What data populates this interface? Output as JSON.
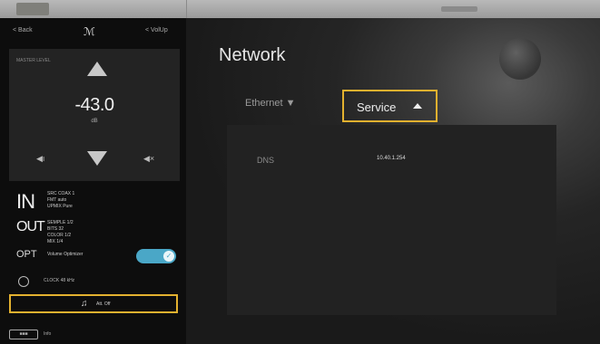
{
  "topbar": {},
  "sidebar": {
    "back_label": "< Back",
    "brand": "ℳ",
    "volume_up_label": "< VolUp",
    "volume": {
      "label": "MASTER LEVEL",
      "value": "-43.0",
      "unit": "dB"
    },
    "in_block": {
      "title": "IN",
      "lines": [
        "SRC  COAX 1",
        "FMT  auto",
        "UPMIX  Pure"
      ]
    },
    "out_block": {
      "title": "OUT",
      "lines": [
        "SEMPLE  1/2",
        "BITS  32",
        "COLOR  1/2",
        "MIX  1/4"
      ]
    },
    "opt": {
      "title": "OPT",
      "name": "Volume Optimizer",
      "enabled": true
    },
    "clock": {
      "text": "CLOCK  48 kHz"
    },
    "headphone": {
      "text": "Att.  Off"
    },
    "info": {
      "icon_text": "■■■",
      "text": "Info"
    }
  },
  "main": {
    "title": "Network",
    "tabs": [
      {
        "label": "Ethernet ▼",
        "active": false
      },
      {
        "label": "Service",
        "active": true
      }
    ],
    "service": {
      "dns_label": "DNS",
      "dns_value": "10.40.1.254"
    }
  },
  "colors": {
    "accent_outline": "#e3b12f",
    "toggle_on": "#4aa7c7"
  }
}
